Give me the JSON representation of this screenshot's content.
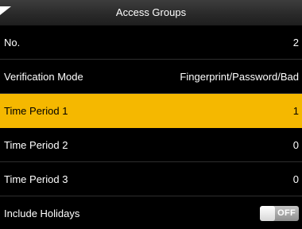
{
  "header": {
    "title": "Access Groups",
    "back_icon": "corner-back-icon"
  },
  "rows": [
    {
      "label": "No.",
      "value": "2"
    },
    {
      "label": "Verification Mode",
      "value": "Fingerprint/Password/Bad"
    },
    {
      "label": "Time Period 1",
      "value": "1"
    },
    {
      "label": "Time Period 2",
      "value": "0"
    },
    {
      "label": "Time Period 3",
      "value": "0"
    },
    {
      "label": "Include Holidays",
      "toggle_text": "OFF",
      "toggle_on": false
    }
  ],
  "selected_row": "Time Period 1",
  "colors": {
    "background": "#000000",
    "header": "#2a2a2a",
    "selected": "#f5b800",
    "text": "#ffffff"
  }
}
